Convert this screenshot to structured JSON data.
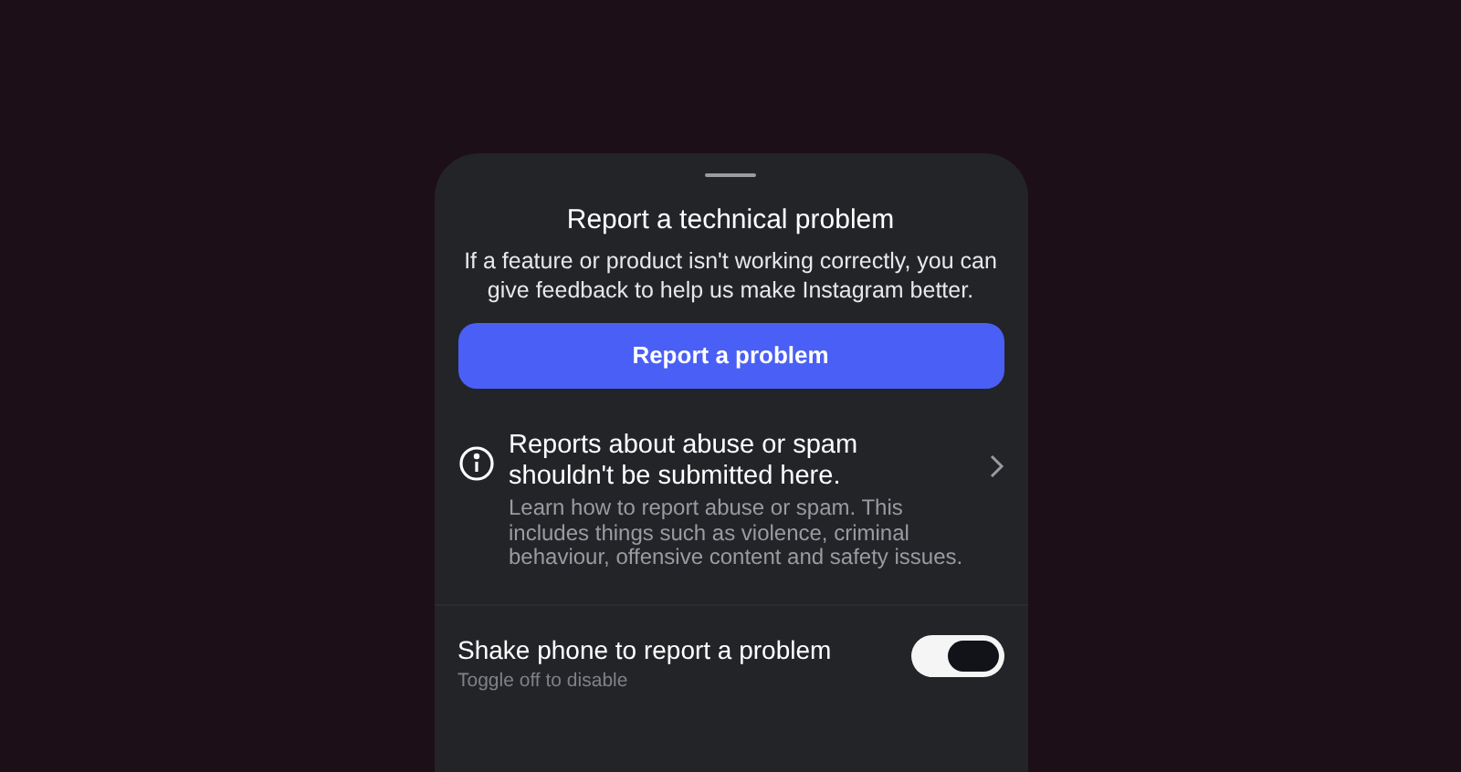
{
  "sheet": {
    "title": "Report a technical problem",
    "description": "If a feature or product isn't working correctly, you can give feedback to help us make Instagram better.",
    "primary_button": "Report a problem",
    "info_row": {
      "title": "Reports about abuse or spam shouldn't be submitted here.",
      "description": "Learn how to report abuse or spam. This includes things such as violence, criminal behaviour, offensive content and safety issues."
    },
    "setting": {
      "label": "Shake phone to report a problem",
      "hint": "Toggle off to disable",
      "on": true
    }
  }
}
